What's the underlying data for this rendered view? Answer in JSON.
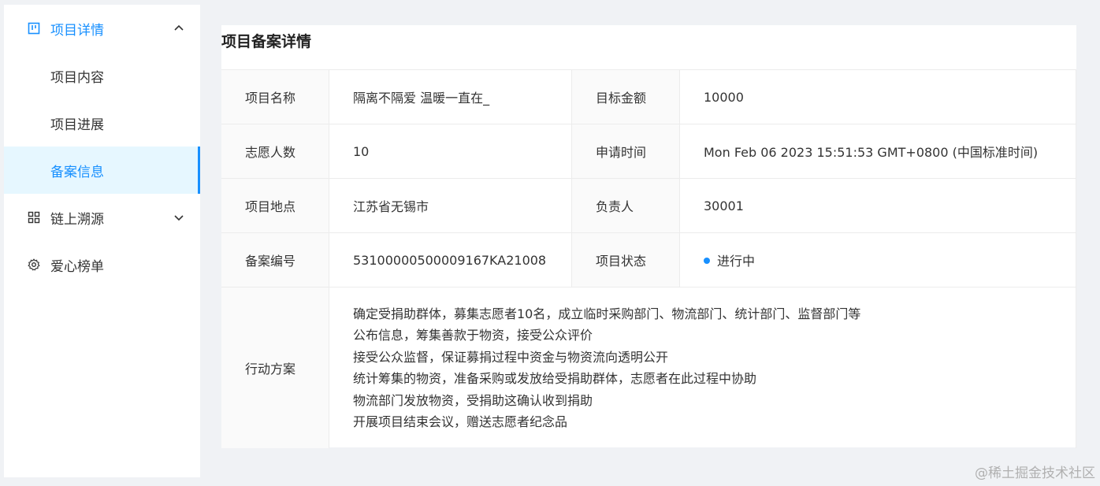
{
  "sidebar": {
    "project_detail": {
      "label": "项目详情",
      "icon": "board-icon"
    },
    "sub_items": [
      {
        "label": "项目内容"
      },
      {
        "label": "项目进展"
      },
      {
        "label": "备案信息"
      }
    ],
    "chain_trace": {
      "label": "链上溯源",
      "icon": "grid-icon"
    },
    "love_rank": {
      "label": "爱心榜单",
      "icon": "gear-icon"
    }
  },
  "main": {
    "title": "项目备案详情",
    "rows": [
      {
        "l1": "项目名称",
        "v1": "隔离不隔爱 温暖一直在_",
        "l2": "目标金额",
        "v2": "10000"
      },
      {
        "l1": "志愿人数",
        "v1": "10",
        "l2": "申请时间",
        "v2": "Mon Feb 06 2023 15:51:53 GMT+0800 (中国标准时间)"
      },
      {
        "l1": "项目地点",
        "v1": "江苏省无锡市",
        "l2": "负责人",
        "v2": "30001"
      },
      {
        "l1": "备案编号",
        "v1": "53100000500009167KA21008",
        "l2": "项目状态",
        "v2": "进行中"
      }
    ],
    "plan_label": "行动方案",
    "plan_lines": [
      "确定受捐助群体，募集志愿者10名，成立临时采购部门、物流部门、统计部门、监督部门等",
      "公布信息，筹集善款于物资，接受公众评价",
      "接受公众监督，保证募捐过程中资金与物资流向透明公开",
      "统计筹集的物资，准备采购或发放给受捐助群体，志愿者在此过程中协助",
      "物流部门发放物资，受捐助这确认收到捐助",
      "开展项目结束会议，赠送志愿者纪念品"
    ],
    "status_color": "#1890ff"
  },
  "watermark": "@稀土掘金技术社区"
}
